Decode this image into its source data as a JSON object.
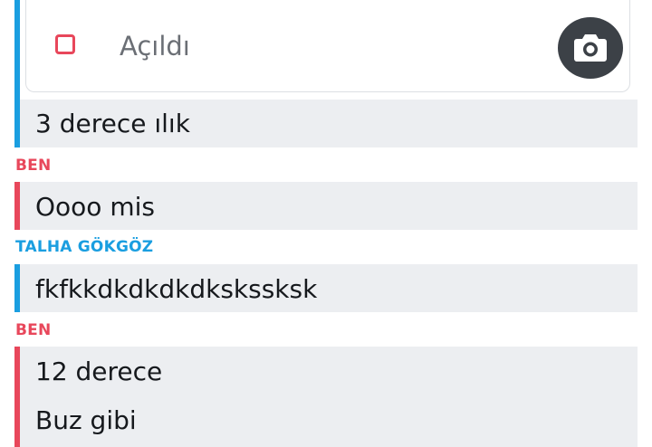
{
  "snap": {
    "status": "Açıldı",
    "camera_icon": "camera-icon"
  },
  "messages": [
    {
      "text": "3 derece ılık"
    },
    {
      "sender": "BEN",
      "text": "Oooo mis"
    },
    {
      "sender": "TALHA GÖKGÖZ",
      "text": "fkfkkdkdkdkdkskssksk"
    },
    {
      "sender": "BEN",
      "texts": [
        "12 derece",
        "Buz gibi"
      ]
    }
  ],
  "colors": {
    "me": "#e8475b",
    "friend": "#1a9ee0"
  }
}
